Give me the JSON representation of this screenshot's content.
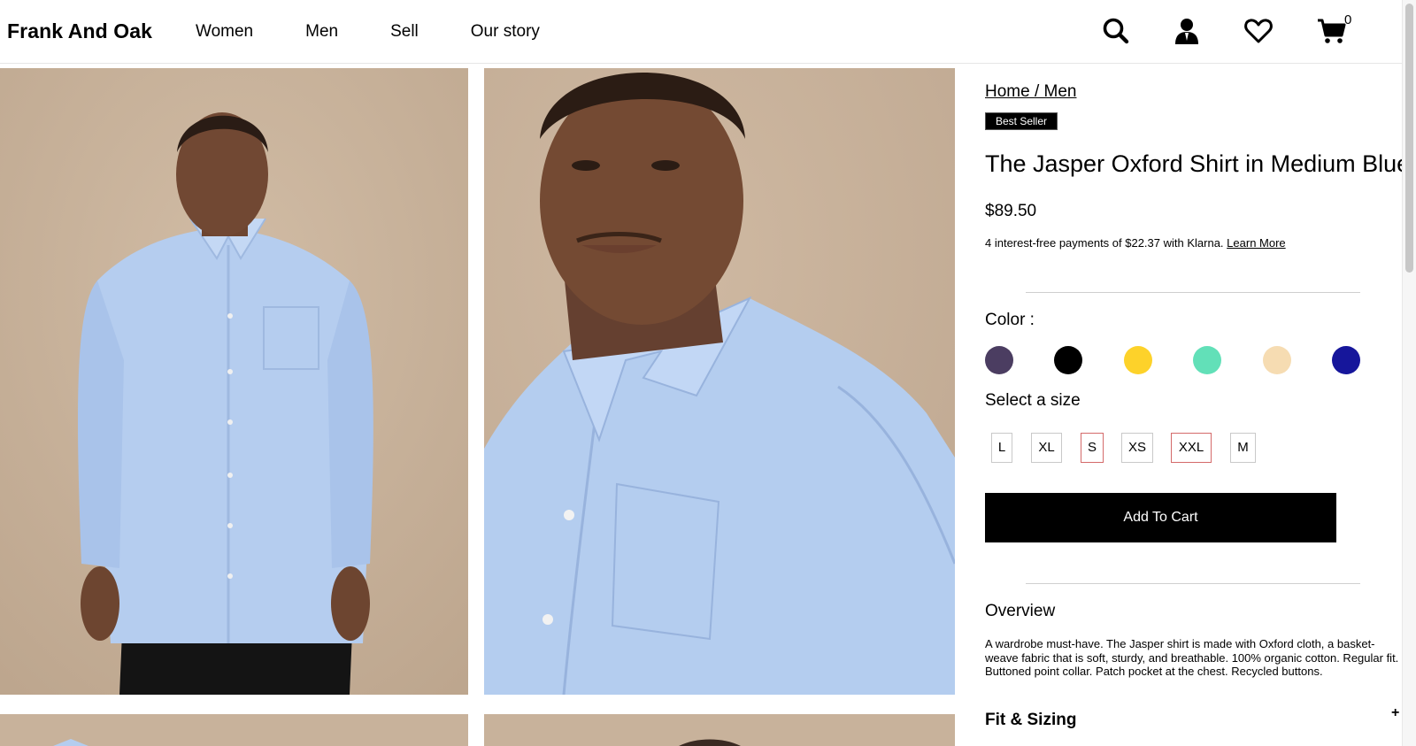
{
  "header": {
    "brand": "Frank And Oak",
    "nav": [
      "Women",
      "Men",
      "Sell",
      "Our story"
    ],
    "icons": [
      "search-icon",
      "account-icon",
      "heart-icon",
      "cart-icon"
    ],
    "cart_count": "0"
  },
  "product": {
    "breadcrumb": "Home / Men",
    "badge": "Best Seller",
    "title": "The Jasper Oxford Shirt in Medium Blue",
    "price": "$89.50",
    "klarna_text": "4 interest-free payments of $22.37 with Klarna.",
    "klarna_link": "Learn More",
    "color_label": "Color :",
    "colors": [
      "#4b3d61",
      "#000000",
      "#fdd22a",
      "#62e0b8",
      "#f6dcb2",
      "#16169b"
    ],
    "size_label": "Select a size",
    "sizes": [
      "L",
      "XL",
      "S",
      "XS",
      "XXL",
      "M"
    ],
    "add_to_cart": "Add To Cart",
    "overview_heading": "Overview",
    "overview_text": "A wardrobe must-have. The Jasper shirt is made with Oxford cloth, a basket-weave fabric that is soft, sturdy, and breathable. 100% organic cotton. Regular fit. Buttoned point collar. Patch pocket at the chest. Recycled buttons.",
    "fit_heading": "Fit & Sizing",
    "fit_toggle": "+"
  },
  "colors": {
    "backdrop": "#c9b39c",
    "shirt": "#b4cdef",
    "skin": "#6e4731"
  }
}
